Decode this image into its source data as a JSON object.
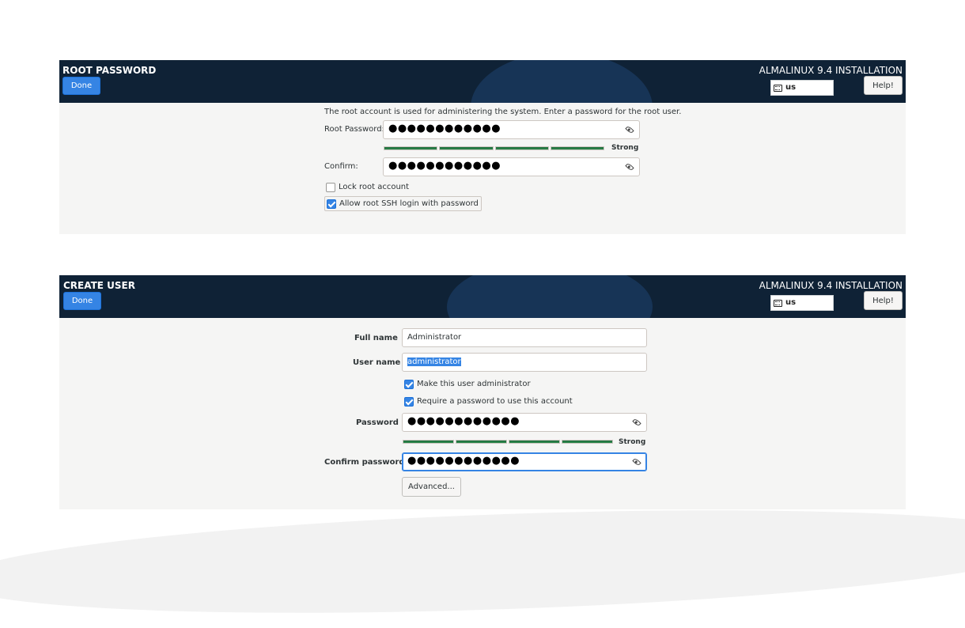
{
  "root_password": {
    "header": {
      "title": "ROOT PASSWORD",
      "done_label": "Done",
      "installation_title": "ALMALINUX 9.4 INSTALLATION",
      "keyboard_layout": "us",
      "help_label": "Help!"
    },
    "description": "The root account is used for administering the system.  Enter a password for the root user.",
    "password_label": "Root Password:",
    "password_value": "●●●●●●●●●●●●",
    "strength_label": "Strong",
    "confirm_label": "Confirm:",
    "confirm_value": "●●●●●●●●●●●●",
    "lock_root_label": "Lock root account",
    "lock_root_checked": false,
    "allow_ssh_label": "Allow root SSH login with password",
    "allow_ssh_checked": true
  },
  "create_user": {
    "header": {
      "title": "CREATE USER",
      "done_label": "Done",
      "installation_title": "ALMALINUX 9.4 INSTALLATION",
      "keyboard_layout": "us",
      "help_label": "Help!"
    },
    "full_name_label": "Full name",
    "full_name_value": "Administrator",
    "user_name_label": "User name",
    "user_name_value": "administrator",
    "make_admin_label": "Make this user administrator",
    "make_admin_checked": true,
    "require_password_label": "Require a password to use this account",
    "require_password_checked": true,
    "password_label": "Password",
    "password_value": "●●●●●●●●●●●●",
    "strength_label": "Strong",
    "confirm_label": "Confirm password",
    "confirm_value": "●●●●●●●●●●●●",
    "advanced_label": "Advanced..."
  },
  "colors": {
    "header_bg": "#0f2236",
    "accent": "#3584e4",
    "strength_bar": "#2d8a4e",
    "panel_bg": "#f5f5f4"
  },
  "icons": [
    "keyboard-icon",
    "eye-icon",
    "checkbox-checked-icon",
    "checkbox-unchecked-icon"
  ]
}
